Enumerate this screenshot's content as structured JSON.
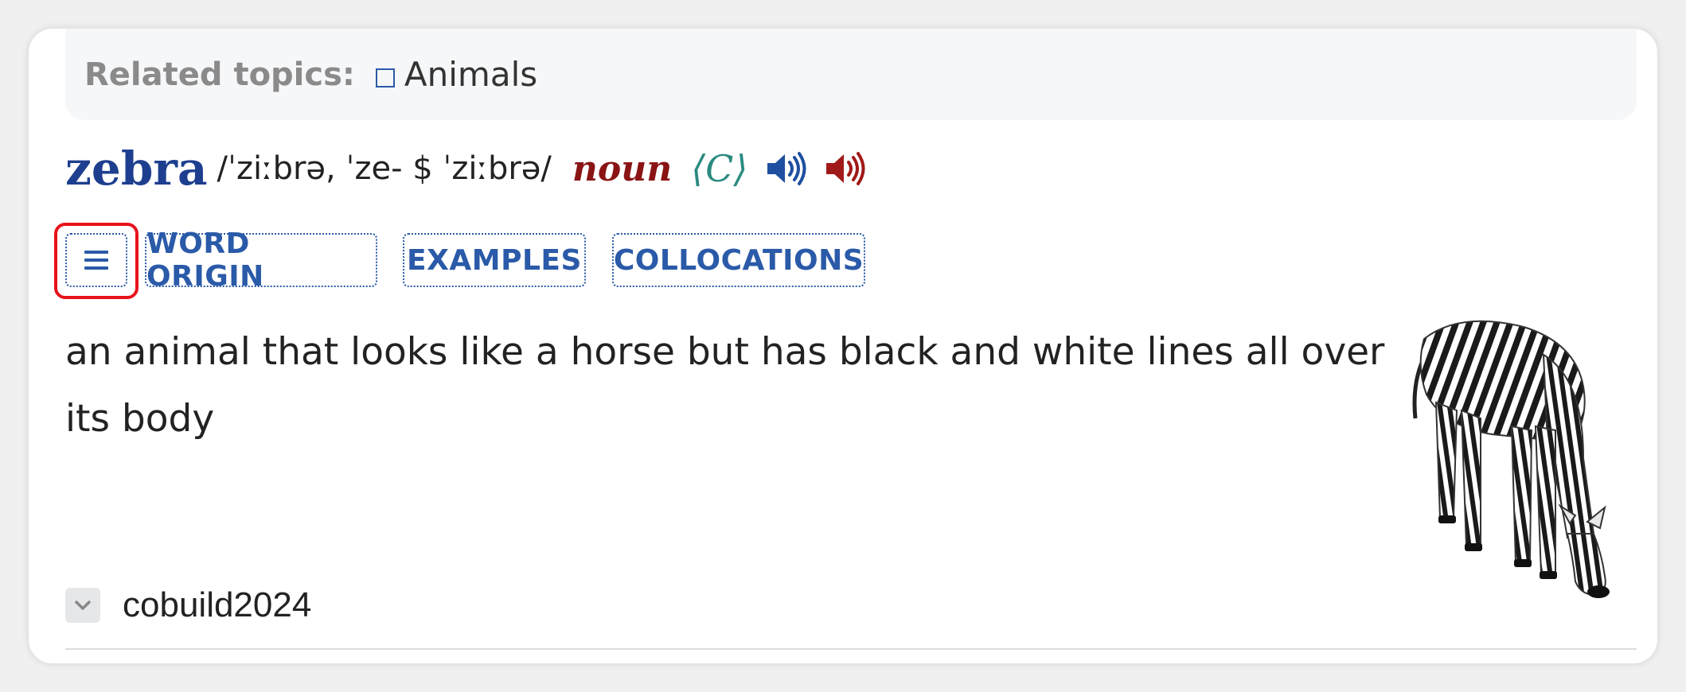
{
  "related_topics": {
    "label": "Related topics:",
    "items": [
      {
        "label": "Animals",
        "icon": "square-outline-icon"
      }
    ]
  },
  "entry": {
    "headword": "zebra",
    "pronunciation": "/ˈziːbrə, ˈze- $ ˈziːbrə/",
    "part_of_speech": "noun",
    "grammar": "⟨C⟩",
    "audio_british_icon": "speaker-icon",
    "audio_american_icon": "speaker-icon",
    "colors": {
      "headword": "#1e3f8f",
      "british_speaker": "#1e4fa0",
      "american_speaker": "#a11a1a",
      "part_of_speech": "#8a1414",
      "grammar": "#2a8a80",
      "buttons": "#2a5aa8",
      "highlight": "#e8121a"
    }
  },
  "toolbar": {
    "menu_icon": "hamburger-menu-icon",
    "buttons": [
      {
        "label": "WORD ORIGIN"
      },
      {
        "label": "EXAMPLES"
      },
      {
        "label": "COLLOCATIONS"
      }
    ]
  },
  "definition": {
    "text": "an animal that looks like a horse but has black and white lines all over its body",
    "image": "zebra-illustration"
  },
  "footer": {
    "collapse_icon": "chevron-down-icon",
    "source": "cobuild2024"
  }
}
